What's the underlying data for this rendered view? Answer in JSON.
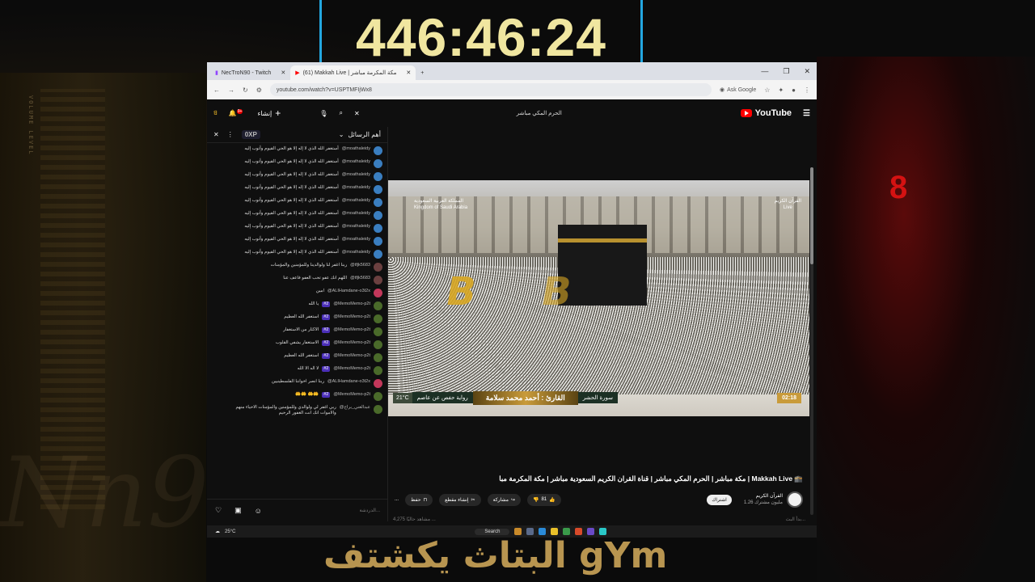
{
  "timer": "446:46:24",
  "caption": "البتاث يكشتف gYm",
  "background": {
    "vertical_text": "VOLUME LEVEL",
    "red_glyph": "8",
    "watermark": "Nn9"
  },
  "browser": {
    "tabs": [
      {
        "label": "NecTroN90 - Twitch",
        "active": false
      },
      {
        "label": "(61) Makkah Live | مكة المكرمة مباشر",
        "active": true
      }
    ],
    "new_tab": "+",
    "window_controls": [
      "—",
      "❐",
      "✕"
    ],
    "url": "youtube.com/watch?v=USPTMFIjWx8",
    "ask_google": "Ask Google"
  },
  "youtube": {
    "create_label": "إنشاء",
    "search_query": "الحرم المكي مباشر",
    "logo_text": "YouTube",
    "notif_count": "9+"
  },
  "chat": {
    "xp": "0XP",
    "title": "أهم الرسائل",
    "messages": [
      {
        "user": "@moathaleidy",
        "text": "أستغفر الله الذي لا إله إلا هو الحي القيوم وأتوب إليه",
        "avatar": "blue"
      },
      {
        "user": "@moathaleidy",
        "text": "أستغفر الله الذي لا إله إلا هو الحي القيوم وأتوب إليه",
        "avatar": "blue"
      },
      {
        "user": "@moathaleidy",
        "text": "أستغفر الله الذي لا إله إلا هو الحي القيوم وأتوب إليه",
        "avatar": "blue"
      },
      {
        "user": "@moathaleidy",
        "text": "أستغفر الله الذي لا إله إلا هو الحي القيوم وأتوب إليه",
        "avatar": "blue"
      },
      {
        "user": "@moathaleidy",
        "text": "أستغفر الله الذي لا إله إلا هو الحي القيوم وأتوب إليه",
        "avatar": "blue"
      },
      {
        "user": "@moathaleidy",
        "text": "أستغفر الله الذي لا إله إلا هو الحي القيوم وأتوب إليه",
        "avatar": "blue"
      },
      {
        "user": "@moathaleidy",
        "text": "أستغفر الله الذي لا إله إلا هو الحي القيوم وأتوب إليه",
        "avatar": "blue"
      },
      {
        "user": "@moathaleidy",
        "text": "أستغفر الله الذي لا إله إلا هو الحي القيوم وأتوب إليه",
        "avatar": "blue"
      },
      {
        "user": "@moathaleidy",
        "text": "أستغفر الله الذي لا إله إلا هو الحي القيوم وأتوب إليه",
        "avatar": "blue"
      },
      {
        "user": "@tfjk5683",
        "text": "ربنا اغفر لنا ولوالدينا وللمؤمنين والمؤمنات",
        "avatar": "t"
      },
      {
        "user": "@tfjk5683",
        "text": "اللهم انك عفو تحب العفو فاعف عنا",
        "avatar": "t"
      },
      {
        "user": "@ALIHamdane-o3t2x",
        "text": "امين",
        "avatar": "a"
      },
      {
        "user": "@MemoMemo-p2t",
        "badge": "#2",
        "text": "يا الله",
        "avatar": "g"
      },
      {
        "user": "@MemoMemo-p2t",
        "badge": "#2",
        "text": "استغفر الله العظيم",
        "avatar": "g"
      },
      {
        "user": "@MemoMemo-p2t",
        "badge": "#2",
        "text": "الاكثار من الاستغفار",
        "avatar": "g"
      },
      {
        "user": "@MemoMemo-p2t",
        "badge": "#2",
        "text": "الاستغفار يشفي القلوب",
        "avatar": "g"
      },
      {
        "user": "@MemoMemo-p2t",
        "badge": "#2",
        "text": "استغفر الله العظيم",
        "avatar": "g"
      },
      {
        "user": "@MemoMemo-p2t",
        "badge": "#2",
        "text": "لا اله الا الله",
        "avatar": "g"
      },
      {
        "user": "@ALIHamdane-o3t2x",
        "text": "ربنا انصر اخواننا الفلسطينيين",
        "avatar": "a"
      },
      {
        "user": "@MemoMemo-p2t",
        "badge": "#2",
        "text": "🤲🤲 🤲🤲",
        "avatar": "g"
      },
      {
        "user": "@عبدالغني_براح",
        "text": "ربي اغفر لي ولوالدي وللمؤمنين والمؤمنات الاحياء منهم والاموات انك انت الغفور الرحيم",
        "avatar": "g"
      }
    ],
    "input_placeholder": "الدردشة..."
  },
  "video": {
    "logo_left": "المملكة العربية السعودية\nKingdom of Saudi Arabia",
    "logo_right": "القرآن الكريم\nLive",
    "temp": "21°C",
    "location": "رواية حفص عن عاصم",
    "reader": "القارئ : أحمد محمد سلامة",
    "surah": "سورة الحشر",
    "time": "02:18",
    "watermark_glyphs": [
      "B",
      "B"
    ]
  },
  "video_title": "مكة مباشر | الحرم المكي مباشر | قناة القران الكريم السعودية مباشر | مكة المكرمة مبا | Makkah Live 🕋",
  "actions": {
    "more": "...",
    "save": "حفظ",
    "clip": "إنشاء مقطع",
    "share": "مشاركة",
    "likes": "81"
  },
  "channel": {
    "subscribe": "اشتراك",
    "name": "القرآن الكريم",
    "subs": "1.26 مليون مشترك"
  },
  "description": {
    "left": "4,275 مشاهد حاليًا ...",
    "right": "بدأ البث..."
  },
  "taskbar": {
    "weather": "25°C",
    "search": "Search"
  },
  "colors": {
    "timer_border": "#23a7e0",
    "timer_text": "#f0e6a0",
    "caption": "#b89550",
    "yt_red": "#ff0000",
    "badge": "#4b2fb8"
  }
}
